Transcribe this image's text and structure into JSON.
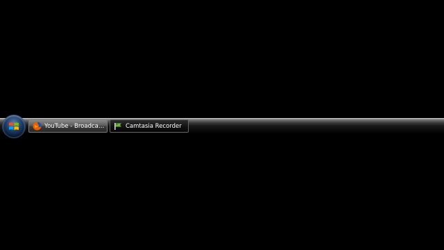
{
  "taskbar": {
    "start_button": {
      "icon": "windows-logo-icon"
    },
    "tasks": [
      {
        "label": "YouTube - Broadcast ...",
        "icon": "firefox-icon",
        "active": true
      },
      {
        "label": "Camtasia Recorder",
        "icon": "camtasia-recorder-icon",
        "active": false
      }
    ]
  },
  "colors": {
    "desktop_background": "#000000",
    "taskbar_highlight": "#9a9a9a",
    "text": "#ffffff"
  }
}
